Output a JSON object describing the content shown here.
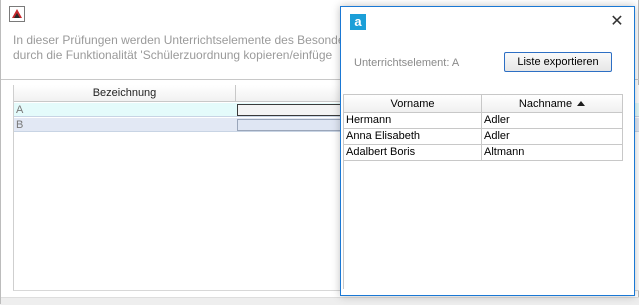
{
  "background": {
    "info_line_1": "In dieser Prüfungen werden Unterrichtselemente des Besonde",
    "info_line_2": "durch die Funktionalität 'Schülerzuordnung kopieren/einfüge",
    "table": {
      "column_header": "Bezeichnung",
      "rows": [
        {
          "label": "A"
        },
        {
          "label": "B"
        }
      ]
    }
  },
  "dialog": {
    "app_icon_letter": "a",
    "close_glyph": "✕",
    "unterrichtselement_label": "Unterrichtselement: A",
    "export_button_label": "Liste exportieren",
    "columns": {
      "vorname": "Vorname",
      "nachname": "Nachname"
    },
    "sorted_column": "Nachname",
    "sort_direction": "ascending",
    "rows": [
      {
        "vorname": "Hermann",
        "nachname": "Adler"
      },
      {
        "vorname": "Anna Elisabeth",
        "nachname": "Adler"
      },
      {
        "vorname": "Adalbert Boris",
        "nachname": "Altmann"
      }
    ]
  },
  "colors": {
    "accent": "#1b9fd8",
    "dialog_border": "#1a78d4",
    "row_a": "#e4fbfb",
    "row_b": "#e2e8f4"
  }
}
